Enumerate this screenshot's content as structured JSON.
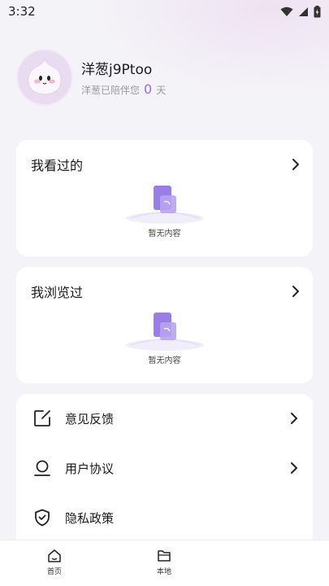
{
  "status": {
    "time": "3:32"
  },
  "profile": {
    "name": "洋葱j9Ptoo",
    "days_prefix": "洋葱已陪伴您",
    "days_value": "0",
    "days_suffix": "天"
  },
  "watched": {
    "title": "我看过的",
    "empty_text": "暂无内容"
  },
  "browsed": {
    "title": "我浏览过",
    "empty_text": "暂无内容"
  },
  "menu": {
    "feedback": "意见反馈",
    "agreement": "用户协议",
    "privacy": "隐私政策"
  },
  "tabs": {
    "home": "首页",
    "local": "本地"
  },
  "colors": {
    "accent": "#a36bd8",
    "illustration": "#9b7de6"
  },
  "icons": [
    "wifi-icon",
    "signal-icon",
    "battery-icon",
    "avatar",
    "chevron-right-icon",
    "empty-document-icon",
    "edit-icon",
    "user-icon",
    "shield-icon",
    "home-icon",
    "folder-icon"
  ]
}
